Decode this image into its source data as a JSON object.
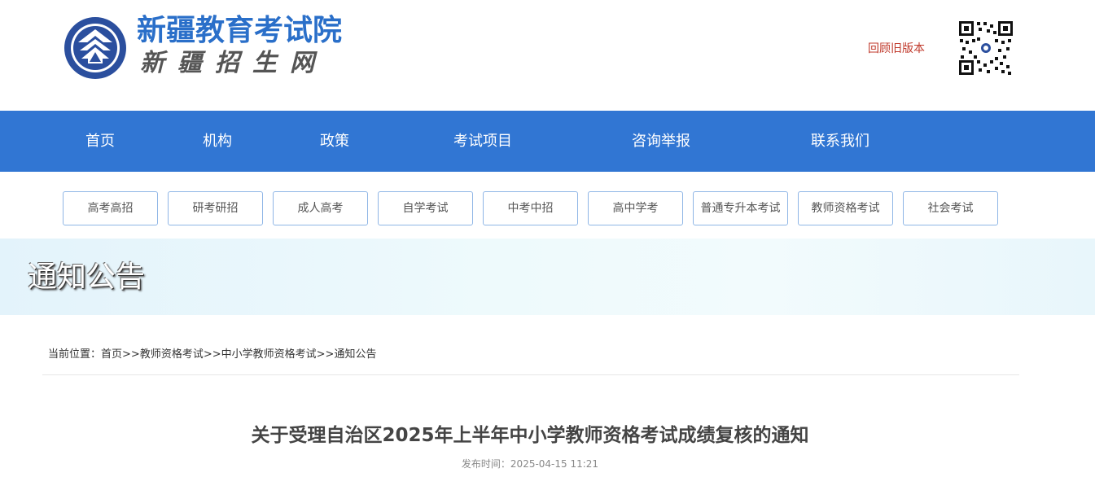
{
  "header": {
    "site_title": "新疆教育考试院",
    "site_subtitle": "新疆招生网",
    "old_version_link": "回顾旧版本",
    "logo_icon": "xjeea-emblem-icon",
    "qr_icon": "qr-code-icon"
  },
  "nav": {
    "items": [
      "首页",
      "机构",
      "政策",
      "考试项目",
      "咨询举报",
      "联系我们"
    ]
  },
  "subnav": {
    "items": [
      "高考高招",
      "研考研招",
      "成人高考",
      "自学考试",
      "中考中招",
      "高中学考",
      "普通专升本考试",
      "教师资格考试",
      "社会考试"
    ]
  },
  "banner": {
    "title": "通知公告"
  },
  "breadcrumb": {
    "prefix": "当前位置：",
    "items": [
      "首页",
      "教师资格考试",
      "中小学教师资格考试",
      "通知公告"
    ],
    "separator": ">>"
  },
  "article": {
    "title": "关于受理自治区2025年上半年中小学教师资格考试成绩复核的通知",
    "publish_time": "发布时间：2025-04-15 11:21"
  },
  "colors": {
    "brand_blue": "#3176d3",
    "title_blue": "#2a6fc9",
    "old_version_red": "#c0392b"
  }
}
